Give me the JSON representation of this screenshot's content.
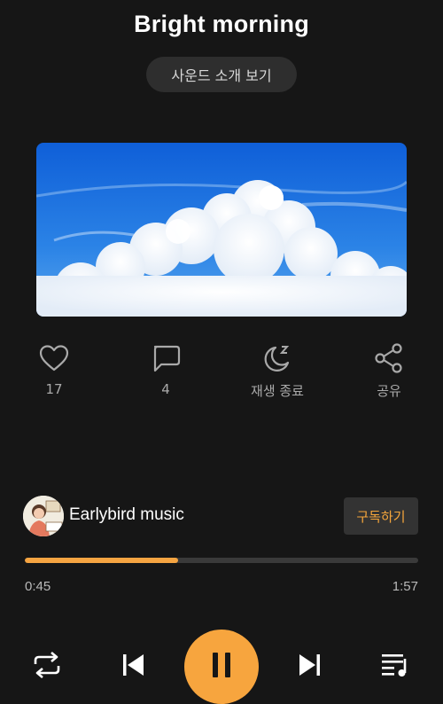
{
  "track": {
    "title": "Bright morning"
  },
  "intro_button": {
    "label": "사운드 소개 보기"
  },
  "actions": [
    {
      "icon": "heart-icon",
      "label": "17"
    },
    {
      "icon": "comment-icon",
      "label": "4"
    },
    {
      "icon": "sleep-timer-icon",
      "label": "재생 종료"
    },
    {
      "icon": "share-icon",
      "label": "공유"
    }
  ],
  "artist": {
    "name": "Earlybird music",
    "subscribe_label": "구독하기"
  },
  "playback": {
    "current_time": "0:45",
    "total_time": "1:57",
    "progress_fraction": 0.39
  },
  "colors": {
    "accent": "#f5a441",
    "background": "#161616",
    "subscribe_text": "#f6a63b"
  }
}
